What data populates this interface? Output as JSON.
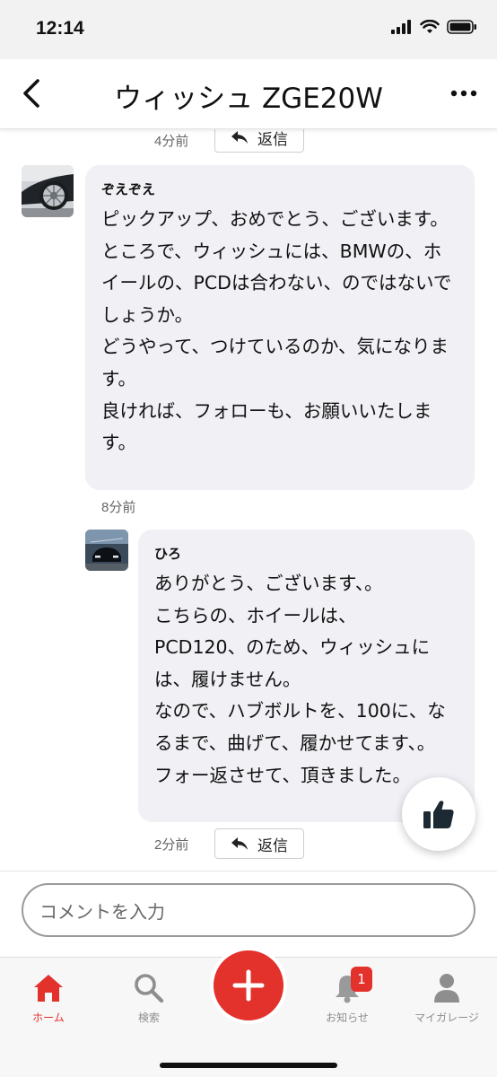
{
  "status_bar": {
    "time": "12:14"
  },
  "header": {
    "title": "ウィッシュ ZGE20W"
  },
  "thread": {
    "top_reply": {
      "timestamp": "4分前",
      "reply_label": "返信"
    },
    "comments": [
      {
        "username": "ぞえぞえ",
        "body": "ピックアップ、おめでとう、ございます。\nところで、ウィッシュには、BMWの、ホイールの、PCDは合わない、のではないでしょうか。\nどうやって、つけているのか、気になります。\n良ければ、フォローも、お願いいたします。",
        "timestamp": "8分前"
      },
      {
        "username": "ひろ",
        "body": "ありがとう、ございます、。\nこちらの、ホイールは、\nPCD120、のため、ウィッシュには、履けません。\nなので、ハブボルトを、100に、なるまで、曲げて、履かせてます、。\nフォー返させて、頂きました。",
        "timestamp": "2分前",
        "reply_label": "返信"
      }
    ]
  },
  "comment_input": {
    "placeholder": "コメントを入力"
  },
  "tabbar": {
    "items": [
      {
        "label": "ホーム",
        "icon": "home-icon"
      },
      {
        "label": "検索",
        "icon": "search-icon"
      },
      {
        "label": "",
        "icon": "plus-icon"
      },
      {
        "label": "お知らせ",
        "icon": "bell-icon",
        "badge": "1"
      },
      {
        "label": "マイガレージ",
        "icon": "person-icon"
      }
    ]
  },
  "colors": {
    "accent": "#e3312b",
    "bubble": "#f0f0f5"
  }
}
